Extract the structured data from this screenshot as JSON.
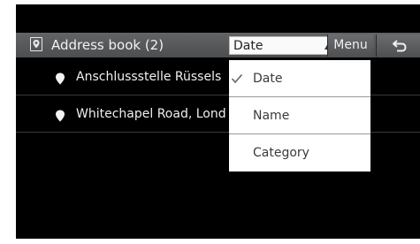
{
  "header": {
    "title": "Address book (2)",
    "icon": "address-book-icon",
    "menu_label": "Menu",
    "back_icon": "back-arrow-icon"
  },
  "sort": {
    "selected": "Date",
    "options": [
      {
        "label": "Date",
        "checked": true
      },
      {
        "label": "Name",
        "checked": false
      },
      {
        "label": "Category",
        "checked": false
      }
    ]
  },
  "entries": [
    {
      "label": "Anschlussstelle Rüssels",
      "icon": "location-pin-icon"
    },
    {
      "label": "Whitechapel Road, Lond",
      "icon": "location-pin-icon"
    }
  ],
  "colors": {
    "background": "#000000",
    "header": "#555759",
    "dropdown": "#ffffff"
  }
}
